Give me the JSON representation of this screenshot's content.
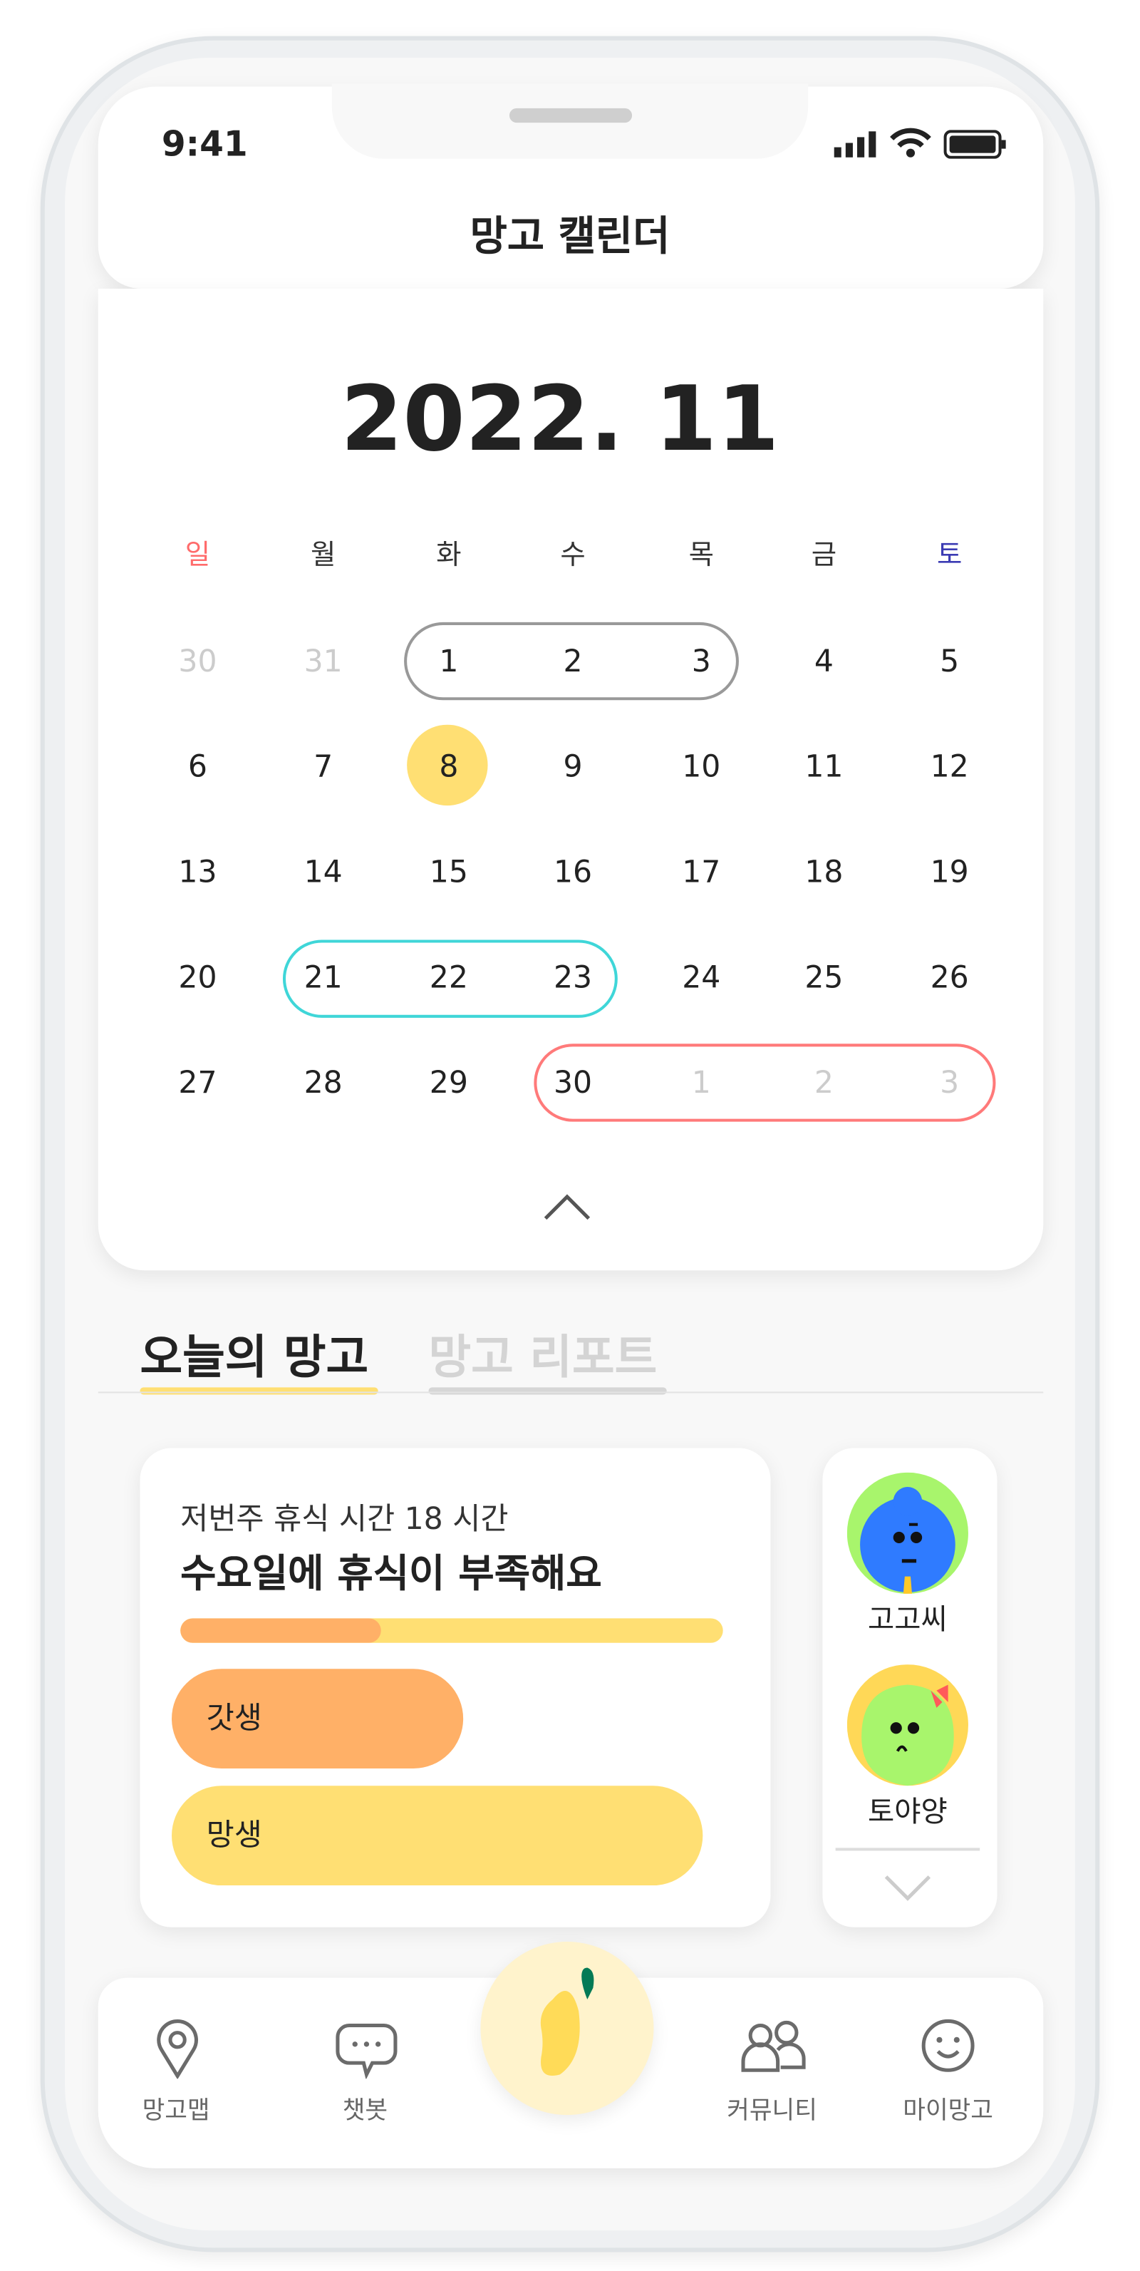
{
  "status_bar": {
    "time": "9:41"
  },
  "header": {
    "title": "망고 캘린더"
  },
  "calendar": {
    "month_label": "2022. 11",
    "weekdays": [
      "일",
      "월",
      "화",
      "수",
      "목",
      "금",
      "토"
    ],
    "weekday_colors": {
      "sunday": "#ff6b6b",
      "saturday": "#3b3bb3"
    },
    "weeks": [
      [
        "30",
        "31",
        "1",
        "2",
        "3",
        "4",
        "5"
      ],
      [
        "6",
        "7",
        "8",
        "9",
        "10",
        "11",
        "12"
      ],
      [
        "13",
        "14",
        "15",
        "16",
        "17",
        "18",
        "19"
      ],
      [
        "20",
        "21",
        "22",
        "23",
        "24",
        "25",
        "26"
      ],
      [
        "27",
        "28",
        "29",
        "30",
        "1",
        "2",
        "3"
      ]
    ],
    "today": "8",
    "today_color": "#ffdf73",
    "ranges": [
      {
        "days": "1-3",
        "color": "#999999"
      },
      {
        "days": "21-23",
        "color": "#3fd6d8"
      },
      {
        "days": "30-3",
        "color": "#ff7a7a"
      }
    ],
    "collapse_icon": "chevron-up-icon"
  },
  "tabs": [
    {
      "label": "오늘의 망고",
      "active": true
    },
    {
      "label": "망고 리포트",
      "active": false
    }
  ],
  "today_card": {
    "subtitle": "저번주 휴식 시간 18 시간",
    "title": "수요일에 휴식이 부족해요",
    "progress": 0.37,
    "bars": [
      {
        "label": "갓생",
        "value": 0.55,
        "color": "#ffb067"
      },
      {
        "label": "망생",
        "value": 1.0,
        "color": "#ffdf73"
      }
    ]
  },
  "friends": [
    {
      "name": "고고씨",
      "avatar_bg": "#a8f56c",
      "face": "#2f7bff"
    },
    {
      "name": "토야양",
      "avatar_bg": "#ffd857",
      "face": "#a8f56c"
    }
  ],
  "bottom_nav": [
    {
      "label": "망고맵",
      "icon": "map-pin-icon"
    },
    {
      "label": "챗봇",
      "icon": "chat-bubble-icon"
    },
    {
      "label": "",
      "icon": "mango-icon"
    },
    {
      "label": "커뮤니티",
      "icon": "people-icon"
    },
    {
      "label": "마이망고",
      "icon": "smile-icon"
    }
  ]
}
